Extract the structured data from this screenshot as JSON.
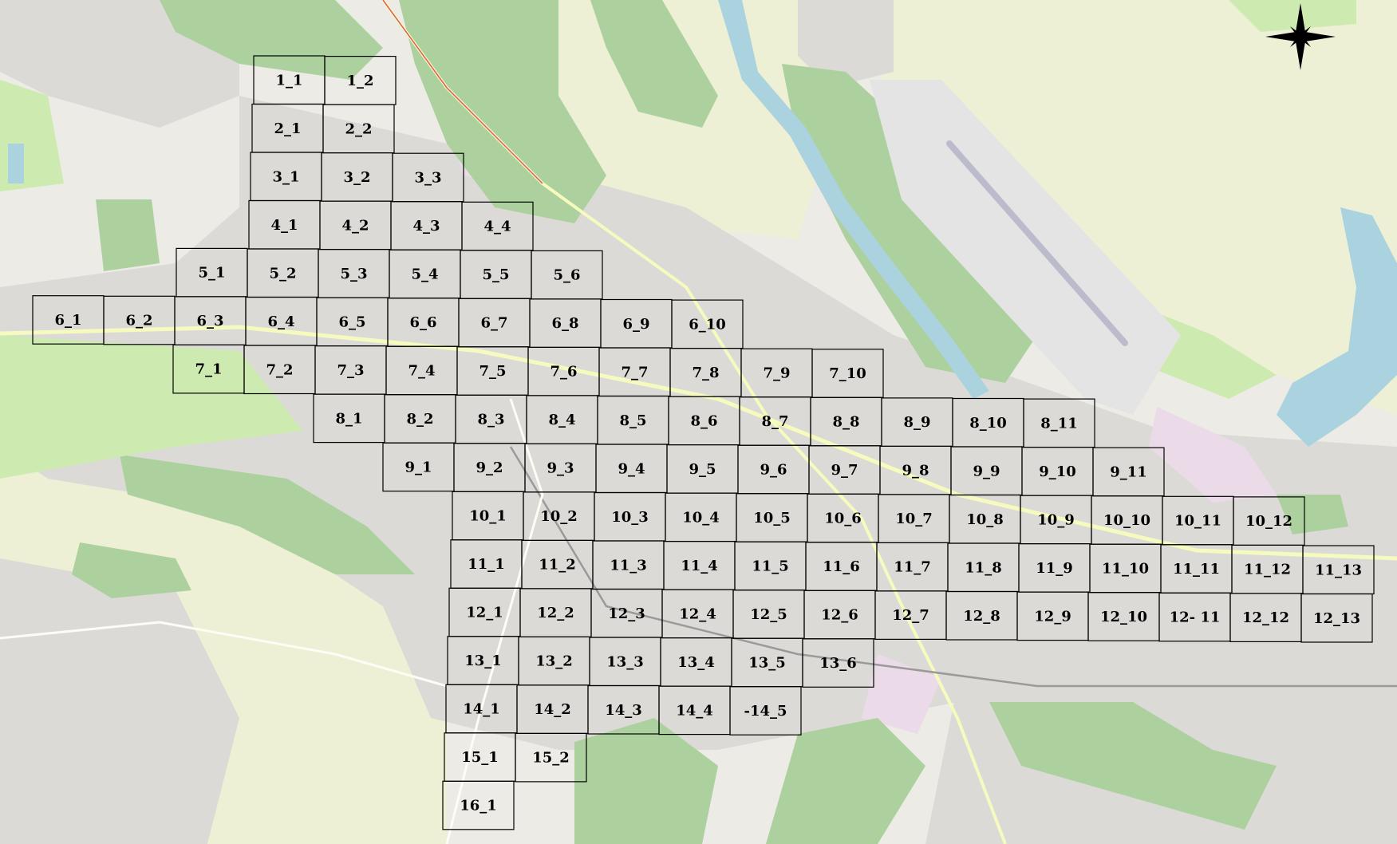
{
  "map": {
    "grid_cells": [
      {
        "label": "1_1",
        "row": 0,
        "col": 0
      },
      {
        "label": "1_2",
        "row": 0,
        "col": 1
      },
      {
        "label": "2_1",
        "row": 1,
        "col": 0
      },
      {
        "label": "2_2",
        "row": 1,
        "col": 1
      },
      {
        "label": "3_1",
        "row": 2,
        "col": 0
      },
      {
        "label": "3_2",
        "row": 2,
        "col": 1
      },
      {
        "label": "3_3",
        "row": 2,
        "col": 2
      },
      {
        "label": "4_1",
        "row": 3,
        "col": 0
      },
      {
        "label": "4_2",
        "row": 3,
        "col": 1
      },
      {
        "label": "4_3",
        "row": 3,
        "col": 2
      },
      {
        "label": "4_4",
        "row": 3,
        "col": 3
      },
      {
        "label": "5_1",
        "row": 4,
        "col": -1
      },
      {
        "label": "5_2",
        "row": 4,
        "col": 0
      },
      {
        "label": "5_3",
        "row": 4,
        "col": 1
      },
      {
        "label": "5_4",
        "row": 4,
        "col": 2
      },
      {
        "label": "5_5",
        "row": 4,
        "col": 3
      },
      {
        "label": "5_6",
        "row": 4,
        "col": 4
      },
      {
        "label": "6_1",
        "row": 5,
        "col": -3
      },
      {
        "label": "6_2",
        "row": 5,
        "col": -2
      },
      {
        "label": "6_3",
        "row": 5,
        "col": -1
      },
      {
        "label": "6_4",
        "row": 5,
        "col": 0
      },
      {
        "label": "6_5",
        "row": 5,
        "col": 1
      },
      {
        "label": "6_6",
        "row": 5,
        "col": 2
      },
      {
        "label": "6_7",
        "row": 5,
        "col": 3
      },
      {
        "label": "6_8",
        "row": 5,
        "col": 4
      },
      {
        "label": "6_9",
        "row": 5,
        "col": 5
      },
      {
        "label": "6_10",
        "row": 5,
        "col": 6
      },
      {
        "label": "7_1",
        "row": 6,
        "col": -1
      },
      {
        "label": "7_2",
        "row": 6,
        "col": 0
      },
      {
        "label": "7_3",
        "row": 6,
        "col": 1
      },
      {
        "label": "7_4",
        "row": 6,
        "col": 2
      },
      {
        "label": "7_5",
        "row": 6,
        "col": 3
      },
      {
        "label": "7_6",
        "row": 6,
        "col": 4
      },
      {
        "label": "7_7",
        "row": 6,
        "col": 5
      },
      {
        "label": "7_8",
        "row": 6,
        "col": 6
      },
      {
        "label": "7_9",
        "row": 6,
        "col": 7
      },
      {
        "label": "7_10",
        "row": 6,
        "col": 8
      },
      {
        "label": "8_1",
        "row": 7,
        "col": 1
      },
      {
        "label": "8_2",
        "row": 7,
        "col": 2
      },
      {
        "label": "8_3",
        "row": 7,
        "col": 3
      },
      {
        "label": "8_4",
        "row": 7,
        "col": 4
      },
      {
        "label": "8_5",
        "row": 7,
        "col": 5
      },
      {
        "label": "8_6",
        "row": 7,
        "col": 6
      },
      {
        "label": "8_7",
        "row": 7,
        "col": 7
      },
      {
        "label": "8_8",
        "row": 7,
        "col": 8
      },
      {
        "label": "8_9",
        "row": 7,
        "col": 9
      },
      {
        "label": "8_10",
        "row": 7,
        "col": 10
      },
      {
        "label": "8_11",
        "row": 7,
        "col": 11
      },
      {
        "label": "9_1",
        "row": 8,
        "col": 2
      },
      {
        "label": "9_2",
        "row": 8,
        "col": 3
      },
      {
        "label": "9_3",
        "row": 8,
        "col": 4
      },
      {
        "label": "9_4",
        "row": 8,
        "col": 5
      },
      {
        "label": "9_5",
        "row": 8,
        "col": 6
      },
      {
        "label": "9_6",
        "row": 8,
        "col": 7
      },
      {
        "label": "9_7",
        "row": 8,
        "col": 8
      },
      {
        "label": "9_8",
        "row": 8,
        "col": 9
      },
      {
        "label": "9_9",
        "row": 8,
        "col": 10
      },
      {
        "label": "9_10",
        "row": 8,
        "col": 11
      },
      {
        "label": "9_11",
        "row": 8,
        "col": 12
      },
      {
        "label": "10_1",
        "row": 9,
        "col": 3
      },
      {
        "label": "10_2",
        "row": 9,
        "col": 4
      },
      {
        "label": "10_3",
        "row": 9,
        "col": 5
      },
      {
        "label": "10_4",
        "row": 9,
        "col": 6
      },
      {
        "label": "10_5",
        "row": 9,
        "col": 7
      },
      {
        "label": "10_6",
        "row": 9,
        "col": 8
      },
      {
        "label": "10_7",
        "row": 9,
        "col": 9
      },
      {
        "label": "10_8",
        "row": 9,
        "col": 10
      },
      {
        "label": "10_9",
        "row": 9,
        "col": 11
      },
      {
        "label": "10_10",
        "row": 9,
        "col": 12
      },
      {
        "label": "10_11",
        "row": 9,
        "col": 13
      },
      {
        "label": "10_12",
        "row": 9,
        "col": 14
      },
      {
        "label": "11_1",
        "row": 10,
        "col": 3
      },
      {
        "label": "11_2",
        "row": 10,
        "col": 4
      },
      {
        "label": "11_3",
        "row": 10,
        "col": 5
      },
      {
        "label": "11_4",
        "row": 10,
        "col": 6
      },
      {
        "label": "11_5",
        "row": 10,
        "col": 7
      },
      {
        "label": "11_6",
        "row": 10,
        "col": 8
      },
      {
        "label": "11_7",
        "row": 10,
        "col": 9
      },
      {
        "label": "11_8",
        "row": 10,
        "col": 10
      },
      {
        "label": "11_9",
        "row": 10,
        "col": 11
      },
      {
        "label": "11_10",
        "row": 10,
        "col": 12
      },
      {
        "label": "11_11",
        "row": 10,
        "col": 13
      },
      {
        "label": "11_12",
        "row": 10,
        "col": 14
      },
      {
        "label": "11_13",
        "row": 10,
        "col": 15
      },
      {
        "label": "12_1",
        "row": 11,
        "col": 3
      },
      {
        "label": "12_2",
        "row": 11,
        "col": 4
      },
      {
        "label": "12_3",
        "row": 11,
        "col": 5
      },
      {
        "label": "12_4",
        "row": 11,
        "col": 6
      },
      {
        "label": "12_5",
        "row": 11,
        "col": 7
      },
      {
        "label": "12_6",
        "row": 11,
        "col": 8
      },
      {
        "label": "12_7",
        "row": 11,
        "col": 9
      },
      {
        "label": "12_8",
        "row": 11,
        "col": 10
      },
      {
        "label": "12_9",
        "row": 11,
        "col": 11
      },
      {
        "label": "12_10",
        "row": 11,
        "col": 12
      },
      {
        "label": "12- 11",
        "row": 11,
        "col": 13
      },
      {
        "label": "12_12",
        "row": 11,
        "col": 14
      },
      {
        "label": "12_13",
        "row": 11,
        "col": 15
      },
      {
        "label": "13_1",
        "row": 12,
        "col": 3
      },
      {
        "label": "13_2",
        "row": 12,
        "col": 4
      },
      {
        "label": "13_3",
        "row": 12,
        "col": 5
      },
      {
        "label": "13_4",
        "row": 12,
        "col": 6
      },
      {
        "label": "13_5",
        "row": 12,
        "col": 7
      },
      {
        "label": "13_6",
        "row": 12,
        "col": 8
      },
      {
        "label": "14_1",
        "row": 13,
        "col": 3
      },
      {
        "label": "14_2",
        "row": 13,
        "col": 4
      },
      {
        "label": "14_3",
        "row": 13,
        "col": 5
      },
      {
        "label": "14_4",
        "row": 13,
        "col": 6
      },
      {
        "label": "-14_5",
        "row": 13,
        "col": 7
      },
      {
        "label": "15_1",
        "row": 14,
        "col": 3
      },
      {
        "label": "15_2",
        "row": 14,
        "col": 4
      },
      {
        "label": "16_1",
        "row": 15,
        "col": 3
      }
    ],
    "compass_icon": "compass-rose-icon",
    "colors": {
      "base": "#ecebe6",
      "urban": "#dcdad6",
      "forest": "#add19e",
      "meadow": "#cdebb0",
      "farmland": "#eef0d5",
      "water": "#aad3df",
      "industrial": "#ebdbe8",
      "runway": "#bbbbcc",
      "road": "#f7fabf",
      "grid_line": "#000000"
    }
  }
}
